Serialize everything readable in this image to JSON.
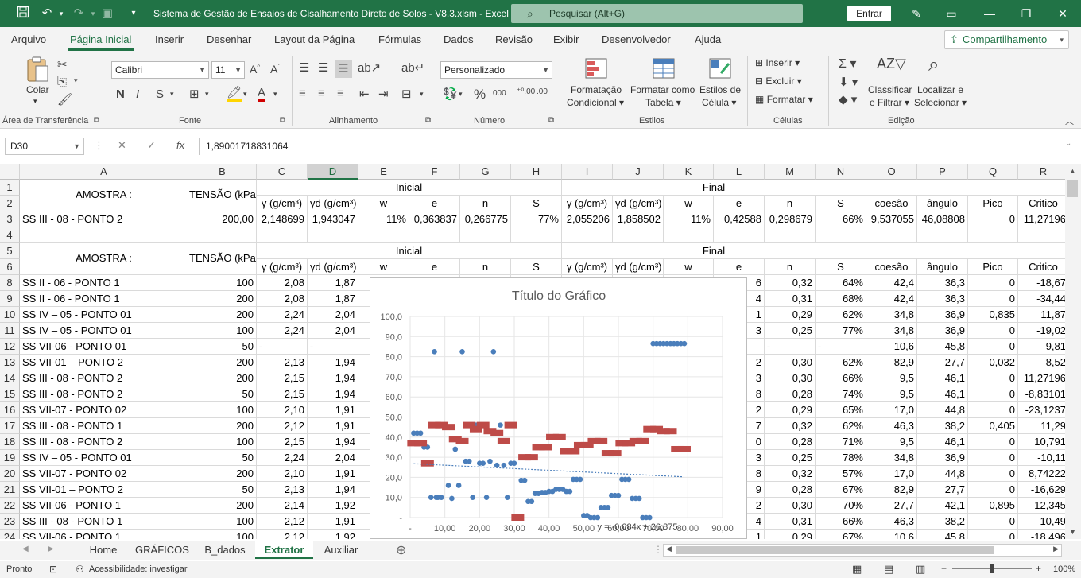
{
  "titlebar": {
    "title": "Sistema de Gestão de Ensaios de Cisalhamento Direto de Solos - V8.3.xlsm  -  Excel",
    "search_placeholder": "Pesquisar (Alt+G)",
    "signin": "Entrar"
  },
  "menu": {
    "tabs": [
      "Arquivo",
      "Página Inicial",
      "Inserir",
      "Desenhar",
      "Layout da Página",
      "Fórmulas",
      "Dados",
      "Revisão",
      "Exibir",
      "Desenvolvedor",
      "Ajuda"
    ],
    "share": "Compartilhamento"
  },
  "ribbon": {
    "clipboard": {
      "paste": "Colar",
      "label": "Área de Transferência"
    },
    "font": {
      "name": "Calibri",
      "size": "11",
      "label": "Fonte"
    },
    "alignment": {
      "label": "Alinhamento"
    },
    "number": {
      "format": "Personalizado",
      "label": "Número"
    },
    "styles": {
      "cond1": "Formatação",
      "cond2": "Condicional",
      "table1": "Formatar como",
      "table2": "Tabela",
      "cell1": "Estilos de",
      "cell2": "Célula",
      "label": "Estilos"
    },
    "cells": {
      "insert": "Inserir",
      "delete": "Excluir",
      "format": "Formatar",
      "label": "Células"
    },
    "editing": {
      "sort1": "Classificar",
      "sort2": "e Filtrar",
      "find1": "Localizar e",
      "find2": "Selecionar",
      "label": "Edição"
    }
  },
  "formula_bar": {
    "name_box": "D30",
    "value": "1,89001718831064"
  },
  "columns": [
    "A",
    "B",
    "C",
    "D",
    "E",
    "F",
    "G",
    "H",
    "I",
    "J",
    "K",
    "L",
    "M",
    "N",
    "O",
    "P",
    "Q",
    "R"
  ],
  "rows": [
    {
      "n": "1",
      "cells": {}
    },
    {
      "n": "2",
      "cells": {
        "C": "γ (g/cm³)",
        "D": "γd (g/cm³)",
        "E": "w",
        "F": "e",
        "G": "n",
        "H": "S",
        "I": "γ (g/cm³)",
        "J": "γd (g/cm³)",
        "K": "w",
        "L": "e",
        "M": "n",
        "N": "S",
        "O": "coesão",
        "P": "ângulo",
        "Q": "Pico",
        "R": "Critico"
      }
    },
    {
      "n": "3",
      "cells": {
        "A": "SS III - 08 - PONTO 2",
        "B": "200,00",
        "C": "2,148699",
        "D": "1,943047",
        "E": "11%",
        "F": "0,363837",
        "G": "0,266775",
        "H": "77%",
        "I": "2,055206",
        "J": "1,858502",
        "K": "11%",
        "L": "0,42588",
        "M": "0,298679",
        "N": "66%",
        "O": "9,537055",
        "P": "46,08808",
        "Q": "0",
        "R": "11,27196"
      }
    },
    {
      "n": "4",
      "cells": {}
    },
    {
      "n": "5",
      "cells": {}
    },
    {
      "n": "6",
      "cells": {
        "C": "γ (g/cm³)",
        "D": "γd (g/cm³)",
        "E": "w",
        "F": "e",
        "G": "n",
        "H": "S",
        "I": "γ (g/cm³)",
        "J": "γd (g/cm³)",
        "K": "w",
        "L": "e",
        "M": "n",
        "N": "S",
        "O": "coesão",
        "P": "ângulo",
        "Q": "Pico",
        "R": "Critico"
      }
    },
    {
      "n": "8",
      "cells": {
        "A": "SS II - 06 - PONTO 1",
        "B": "100",
        "C": "2,08",
        "D": "1,87",
        "L": "6",
        "M": "0,32",
        "N": "64%",
        "O": "42,4",
        "P": "36,3",
        "Q": "0",
        "R": "-18,67"
      }
    },
    {
      "n": "9",
      "cells": {
        "A": "SS II - 06 - PONTO 1",
        "B": "200",
        "C": "2,08",
        "D": "1,87",
        "L": "4",
        "M": "0,31",
        "N": "68%",
        "O": "42,4",
        "P": "36,3",
        "Q": "0",
        "R": "-34,44"
      }
    },
    {
      "n": "10",
      "cells": {
        "A": "SS IV – 05 - PONTO 01",
        "B": "200",
        "C": "2,24",
        "D": "2,04",
        "L": "1",
        "M": "0,29",
        "N": "62%",
        "O": "34,8",
        "P": "36,9",
        "Q": "0,835",
        "R": "11,87"
      }
    },
    {
      "n": "11",
      "cells": {
        "A": "SS IV – 05 - PONTO 01",
        "B": "100",
        "C": "2,24",
        "D": "2,04",
        "L": "3",
        "M": "0,25",
        "N": "77%",
        "O": "34,8",
        "P": "36,9",
        "Q": "0",
        "R": "-19,02"
      }
    },
    {
      "n": "12",
      "cells": {
        "A": "SS VII-06 - PONTO 01",
        "B": "50",
        "C": "-",
        "D": "-",
        "M": "-",
        "N": "-",
        "O": "10,6",
        "P": "45,8",
        "Q": "0",
        "R": "9,81"
      }
    },
    {
      "n": "13",
      "cells": {
        "A": "SS VII-01 – PONTO 2",
        "B": "200",
        "C": "2,13",
        "D": "1,94",
        "L": "2",
        "M": "0,30",
        "N": "62%",
        "O": "82,9",
        "P": "27,7",
        "Q": "0,032",
        "R": "8,52"
      }
    },
    {
      "n": "14",
      "cells": {
        "A": "SS III - 08 - PONTO 2",
        "B": "200",
        "C": "2,15",
        "D": "1,94",
        "L": "3",
        "M": "0,30",
        "N": "66%",
        "O": "9,5",
        "P": "46,1",
        "Q": "0",
        "R": "11,27196"
      }
    },
    {
      "n": "15",
      "cells": {
        "A": "SS III - 08 - PONTO 2",
        "B": "50",
        "C": "2,15",
        "D": "1,94",
        "L": "8",
        "M": "0,28",
        "N": "74%",
        "O": "9,5",
        "P": "46,1",
        "Q": "0",
        "R": "-8,83101"
      }
    },
    {
      "n": "16",
      "cells": {
        "A": "SS VII-07 - PONTO 02",
        "B": "100",
        "C": "2,10",
        "D": "1,91",
        "L": "2",
        "M": "0,29",
        "N": "65%",
        "O": "17,0",
        "P": "44,8",
        "Q": "0",
        "R": "-23,1237"
      }
    },
    {
      "n": "17",
      "cells": {
        "A": "SS III - 08 - PONTO 1",
        "B": "200",
        "C": "2,12",
        "D": "1,91",
        "L": "7",
        "M": "0,32",
        "N": "62%",
        "O": "46,3",
        "P": "38,2",
        "Q": "0,405",
        "R": "11,29"
      }
    },
    {
      "n": "18",
      "cells": {
        "A": "SS III - 08 - PONTO 2",
        "B": "100",
        "C": "2,15",
        "D": "1,94",
        "L": "0",
        "M": "0,28",
        "N": "71%",
        "O": "9,5",
        "P": "46,1",
        "Q": "0",
        "R": "10,791"
      }
    },
    {
      "n": "19",
      "cells": {
        "A": "SS IV – 05 - PONTO 01",
        "B": "50",
        "C": "2,24",
        "D": "2,04",
        "L": "3",
        "M": "0,25",
        "N": "78%",
        "O": "34,8",
        "P": "36,9",
        "Q": "0",
        "R": "-10,11"
      }
    },
    {
      "n": "20",
      "cells": {
        "A": "SS VII-07 - PONTO 02",
        "B": "200",
        "C": "2,10",
        "D": "1,91",
        "L": "8",
        "M": "0,32",
        "N": "57%",
        "O": "17,0",
        "P": "44,8",
        "Q": "0",
        "R": "8,74222"
      }
    },
    {
      "n": "21",
      "cells": {
        "A": "SS VII-01 – PONTO 2",
        "B": "50",
        "C": "2,13",
        "D": "1,94",
        "L": "9",
        "M": "0,28",
        "N": "67%",
        "O": "82,9",
        "P": "27,7",
        "Q": "0",
        "R": "-16,629"
      }
    },
    {
      "n": "22",
      "cells": {
        "A": "SS VII-06 - PONTO 1",
        "B": "200",
        "C": "2,14",
        "D": "1,92",
        "L": "2",
        "M": "0,30",
        "N": "70%",
        "O": "27,7",
        "P": "42,1",
        "Q": "0,895",
        "R": "12,345"
      }
    },
    {
      "n": "23",
      "cells": {
        "A": "SS III - 08 - PONTO 1",
        "B": "100",
        "C": "2,12",
        "D": "1,91",
        "L": "4",
        "M": "0,31",
        "N": "66%",
        "O": "46,3",
        "P": "38,2",
        "Q": "0",
        "R": "10,49"
      }
    },
    {
      "n": "24",
      "cells": {
        "A": "SS VII-06 - PONTO 1",
        "B": "100",
        "C": "2,12",
        "D": "1,92",
        "L": "1",
        "M": "0,29",
        "N": "67%",
        "O": "10,6",
        "P": "45,8",
        "Q": "0",
        "R": "-18,496"
      }
    }
  ],
  "merged": {
    "amostra": "AMOSTRA :",
    "tensao": "TENSÃO (kPa)",
    "inicial": "Inicial",
    "final": "Final"
  },
  "chart_data": {
    "type": "scatter",
    "title": "Título do Gráfico",
    "xlim": [
      0,
      90
    ],
    "ylim": [
      0,
      100
    ],
    "x_ticks": [
      "-",
      "10,00",
      "20,00",
      "30,00",
      "40,00",
      "50,00",
      "60,00",
      "70,00",
      "80,00",
      "90,00"
    ],
    "y_ticks": [
      "-",
      "10,0",
      "20,0",
      "30,0",
      "40,0",
      "50,0",
      "60,0",
      "70,0",
      "80,0",
      "90,0",
      "100,0"
    ],
    "trendline_label": "y = -0,084x + 26,875",
    "trendline": {
      "slope": -0.084,
      "intercept": 26.875,
      "x_from": 1,
      "x_to": 79
    },
    "series": [
      {
        "color": "#4a7ebb",
        "marker": "circle",
        "x": [
          1,
          2,
          3,
          4,
          5,
          6,
          7,
          7.5,
          8,
          9,
          11,
          12,
          13,
          14,
          15,
          16,
          17,
          18,
          19,
          20,
          21,
          22,
          23,
          24,
          25,
          26,
          27,
          28,
          29,
          30,
          31,
          32,
          33,
          34,
          35,
          36,
          37,
          38,
          39,
          40,
          41,
          42,
          43,
          44,
          45,
          46,
          47,
          48,
          49,
          50,
          51,
          52,
          53,
          54,
          55,
          56,
          57,
          58,
          59,
          60,
          61,
          62,
          63,
          64,
          65,
          66,
          67,
          68,
          69,
          70,
          71,
          72,
          73,
          74,
          75,
          76,
          77,
          78,
          79
        ],
        "y": [
          42,
          42,
          42,
          35,
          35,
          10,
          82.5,
          10,
          10,
          10,
          16,
          9.5,
          34,
          16,
          82.5,
          28,
          28,
          10,
          46,
          27,
          27,
          10,
          28,
          82.5,
          26,
          46,
          26,
          10,
          27,
          27,
          0,
          18.5,
          18.5,
          8,
          8,
          12,
          12,
          12.5,
          12.5,
          13,
          13,
          14,
          14,
          14,
          13,
          13,
          19,
          19,
          19,
          1,
          1,
          0,
          0,
          0,
          5,
          5,
          5,
          11,
          11,
          11,
          19,
          19,
          19,
          9.5,
          9.5,
          9.5,
          0,
          0,
          0,
          86.5,
          86.5,
          86.5,
          86.5,
          86.5,
          86.5,
          86.5,
          86.5,
          86.5,
          86.5
        ]
      },
      {
        "color": "#be4b48",
        "marker": "square",
        "x": [
          1,
          3,
          5,
          7,
          9,
          11,
          13,
          15,
          17,
          19,
          21,
          23,
          25,
          27,
          29,
          31,
          33,
          35,
          37,
          39,
          41,
          43,
          45,
          47,
          49,
          51,
          53,
          55,
          57,
          59,
          61,
          63,
          65,
          67,
          69,
          71,
          73,
          75,
          77,
          79
        ],
        "y": [
          37,
          37,
          27,
          46,
          46,
          45,
          39,
          38,
          46,
          44,
          46,
          43,
          42,
          38,
          46,
          0,
          30,
          30,
          35,
          35,
          40,
          40,
          33,
          33,
          36,
          36,
          38,
          38,
          32,
          32,
          37,
          37,
          38,
          38,
          44,
          44,
          43,
          43,
          34,
          34
        ]
      }
    ]
  },
  "sheets": [
    "Home",
    "GRÁFICOS",
    "B_dados",
    "Extrator",
    "Auxiliar"
  ],
  "active_sheet": "Extrator",
  "status": {
    "ready": "Pronto",
    "accessibility": "Acessibilidade: investigar",
    "zoom": "100%"
  }
}
